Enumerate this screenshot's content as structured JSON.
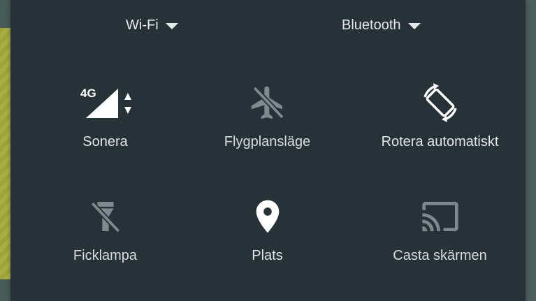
{
  "colors": {
    "panel_bg": "#263238",
    "icon_active": "#ffffff",
    "icon_inactive": "#7d8a8f",
    "text": "#e3e6e7"
  },
  "toggles": {
    "wifi": {
      "label": "Wi-Fi",
      "icon": "chevron-down-icon"
    },
    "bluetooth": {
      "label": "Bluetooth",
      "icon": "chevron-down-icon"
    }
  },
  "tiles": [
    {
      "label": "Sonera",
      "icon": "cellular-signal-4g-icon",
      "badge": "4G",
      "active": true
    },
    {
      "label": "Flygplansläge",
      "icon": "airplane-mode-off-icon",
      "active": false
    },
    {
      "label": "Rotera automatiskt",
      "icon": "auto-rotate-icon",
      "active": true
    },
    {
      "label": "Ficklampa",
      "icon": "flashlight-off-icon",
      "active": false
    },
    {
      "label": "Plats",
      "icon": "location-pin-icon",
      "active": true
    },
    {
      "label": "Casta skärmen",
      "icon": "cast-screen-icon",
      "active": false
    }
  ]
}
